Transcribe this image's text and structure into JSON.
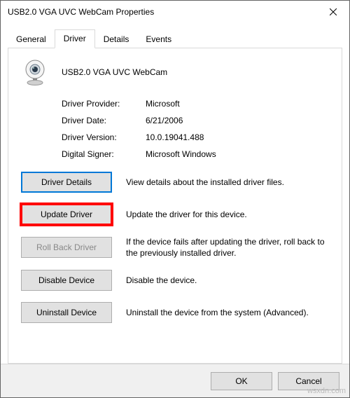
{
  "window": {
    "title": "USB2.0 VGA UVC WebCam Properties"
  },
  "tabs": {
    "general": "General",
    "driver": "Driver",
    "details": "Details",
    "events": "Events"
  },
  "device_name": "USB2.0 VGA UVC WebCam",
  "info": {
    "provider_label": "Driver Provider:",
    "provider_value": "Microsoft",
    "date_label": "Driver Date:",
    "date_value": "6/21/2006",
    "version_label": "Driver Version:",
    "version_value": "10.0.19041.488",
    "signer_label": "Digital Signer:",
    "signer_value": "Microsoft Windows"
  },
  "buttons": {
    "driver_details": "Driver Details",
    "update_driver": "Update Driver",
    "roll_back": "Roll Back Driver",
    "disable_device": "Disable Device",
    "uninstall_device": "Uninstall Device",
    "ok": "OK",
    "cancel": "Cancel"
  },
  "descriptions": {
    "driver_details": "View details about the installed driver files.",
    "update_driver": "Update the driver for this device.",
    "roll_back": "If the device fails after updating the driver, roll back to the previously installed driver.",
    "disable_device": "Disable the device.",
    "uninstall_device": "Uninstall the device from the system (Advanced)."
  },
  "watermark": "wsxdn.com"
}
